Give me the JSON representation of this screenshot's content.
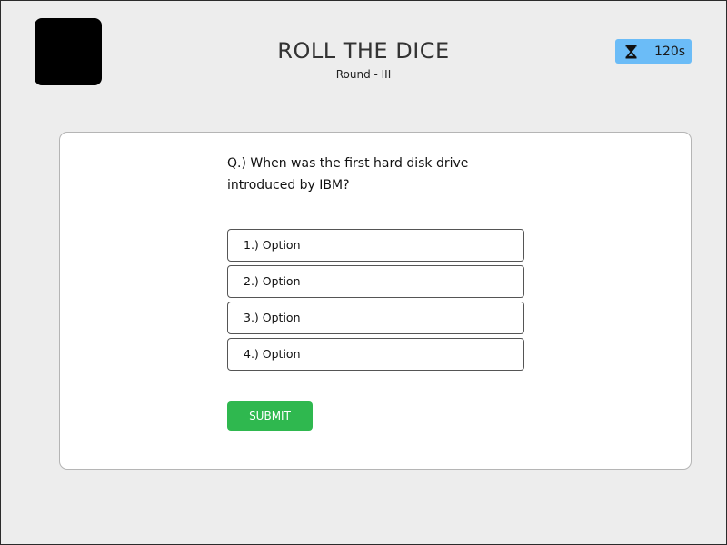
{
  "header": {
    "title": "ROLL THE DICE",
    "round": "Round - III"
  },
  "timer": {
    "icon": "hourglass-icon",
    "value": "120s",
    "color": "#6bbcf7"
  },
  "quiz": {
    "question": "Q.) When was the first hard disk drive introduced by IBM?",
    "options": [
      {
        "label": "1.) Option"
      },
      {
        "label": "2.) Option"
      },
      {
        "label": "3.) Option"
      },
      {
        "label": "4.) Option"
      }
    ],
    "submit_label": "SUBMIT",
    "submit_color": "#2fb84f"
  }
}
